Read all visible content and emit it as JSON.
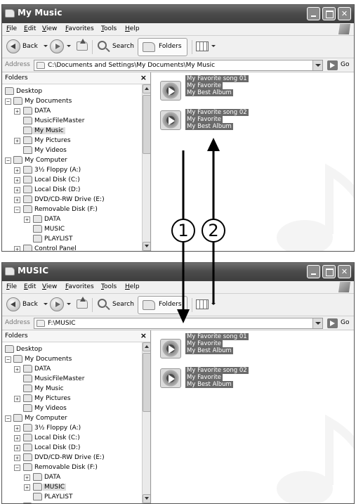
{
  "menu": [
    "File",
    "Edit",
    "View",
    "Favorites",
    "Tools",
    "Help"
  ],
  "toolbar": {
    "back": "Back",
    "search": "Search",
    "folders": "Folders"
  },
  "address_label": "Address",
  "go_label": "Go",
  "pane_title": "Folders",
  "pane_close": "×",
  "tree_labels": {
    "desktop": "Desktop",
    "my_documents": "My Documents",
    "data": "DATA",
    "musicfilemaster": "MusicFileMaster",
    "my_music": "My Music",
    "my_pictures": "My Pictures",
    "my_videos": "My Videos",
    "my_computer": "My Computer",
    "floppy": "3½ Floppy (A:)",
    "disk_c": "Local Disk (C:)",
    "disk_d": "Local Disk (D:)",
    "dvd": "DVD/CD-RW Drive (E:)",
    "removable": "Removable Disk (F:)",
    "rdata": "DATA",
    "music": "MUSIC",
    "playlist": "PLAYLIST",
    "control_panel": "Control Panel"
  },
  "files": [
    {
      "song": "My Favorite song 01",
      "artist": "My Favorite",
      "album": "My  Best Album"
    },
    {
      "song": "My Favorite song 02",
      "artist": "My Favorite",
      "album": "My  Best Album"
    }
  ],
  "windows": [
    {
      "title": "My Music",
      "address": "C:\\Documents and Settings\\My Documents\\My Music"
    },
    {
      "title": "MUSIC",
      "address": "F:\\MUSIC"
    }
  ],
  "callouts": [
    "1",
    "2"
  ]
}
